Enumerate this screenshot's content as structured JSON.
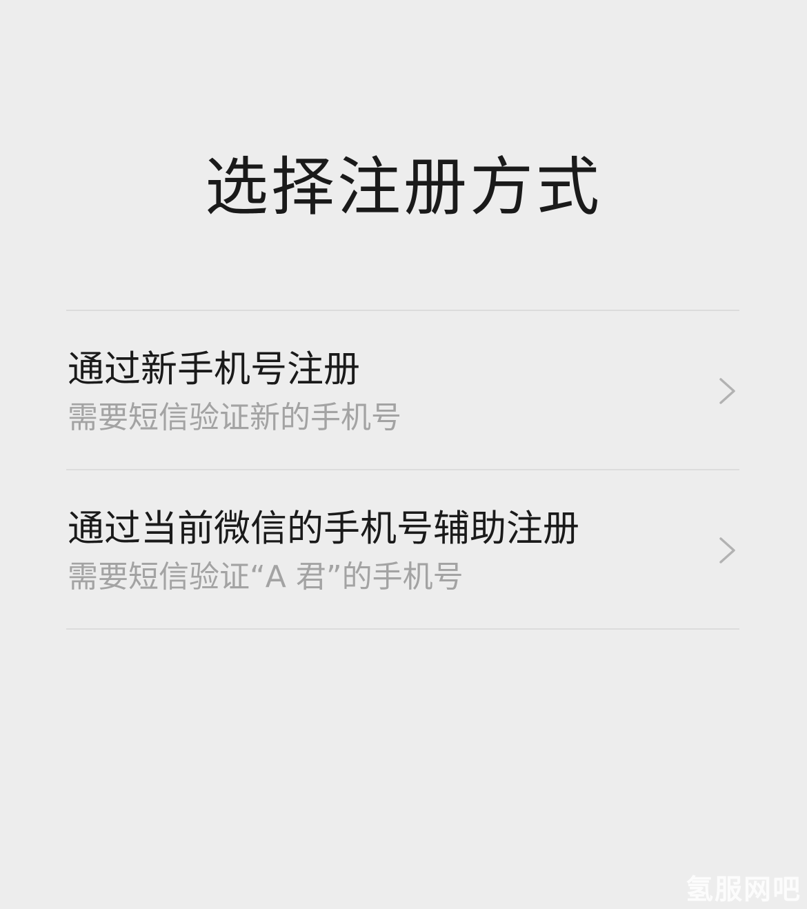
{
  "page": {
    "title": "选择注册方式"
  },
  "options": [
    {
      "title": "通过新手机号注册",
      "subtitle": "需要短信验证新的手机号",
      "icon": "chevron-right-icon"
    },
    {
      "title": "通过当前微信的手机号辅助注册",
      "subtitle": "需要短信验证“A 君”的手机号",
      "icon": "chevron-right-icon"
    }
  ],
  "watermark": {
    "text": "氢服网吧"
  },
  "colors": {
    "background": "#ededed",
    "title_text": "#1a1a1a",
    "subtitle_text": "#a3a3a3",
    "divider": "#dcdcdc",
    "chevron": "#b2b2b2"
  }
}
